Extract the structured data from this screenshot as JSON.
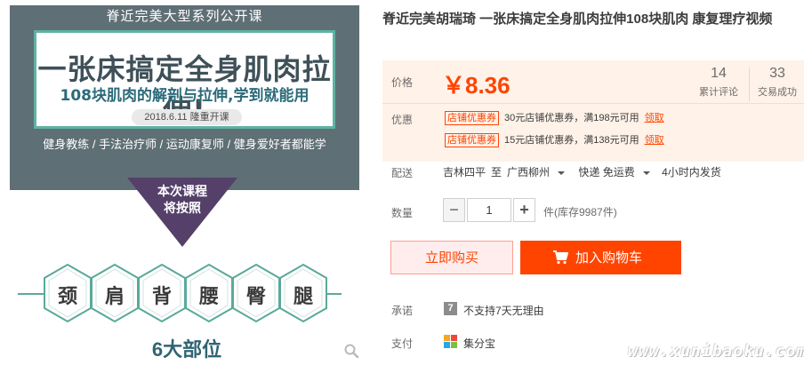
{
  "product_image": {
    "banner_label": "脊近完美大型系列公开课",
    "headline": "一张床搞定全身肌肉拉伸!",
    "subheadline": "108块肌肉的解剖与拉伸,学到就能用",
    "date_badge": "2018.6.11 隆重开课",
    "audience": "健身教练 / 手法治疗师 / 运动康复师 / 健身爱好者都能学",
    "arrow_text_1": "本次课程",
    "arrow_text_2": "将按照",
    "body_parts": [
      "颈",
      "肩",
      "背",
      "腰",
      "臀",
      "腿"
    ],
    "parts_label": "6大部位",
    "zoom_icon": "magnifier-icon"
  },
  "title": "脊近完美胡瑞琦 一张床搞定全身肌肉拉伸108块肌肉 康复理疗视频",
  "price": {
    "label": "价格",
    "value": "￥8.36",
    "reviews_count": "14",
    "reviews_label": "累计评论",
    "sales_count": "33",
    "sales_label": "交易成功"
  },
  "promo": {
    "label": "优惠",
    "coupons": [
      {
        "tag": "店铺优惠券",
        "text": "30元店铺优惠券，满198元可用",
        "link": "领取"
      },
      {
        "tag": "店铺优惠券",
        "text": "15元店铺优惠券，满138元可用",
        "link": "领取"
      }
    ]
  },
  "shipping": {
    "label": "配送",
    "from": "吉林四平",
    "to_word": "至",
    "destination": "广西柳州",
    "method": "快递 免运费",
    "dispatch": "4小时内发货"
  },
  "quantity": {
    "label": "数量",
    "value": "1",
    "stock": "件(库存9987件)"
  },
  "actions": {
    "buy_now": "立即购买",
    "add_to_cart": "加入购物车"
  },
  "promise": {
    "label": "承诺",
    "icon_char": "7",
    "text": "不支持7天无理由"
  },
  "payment": {
    "label": "支付",
    "text": "集分宝"
  },
  "watermark": "www.xunibaoku.com",
  "colors": {
    "accent": "#ff4400",
    "price_panel_bg": "#fff2e8",
    "banner_bg": "#5f6f76",
    "arrow": "#55406a",
    "hex_border": "#5aa99a"
  }
}
